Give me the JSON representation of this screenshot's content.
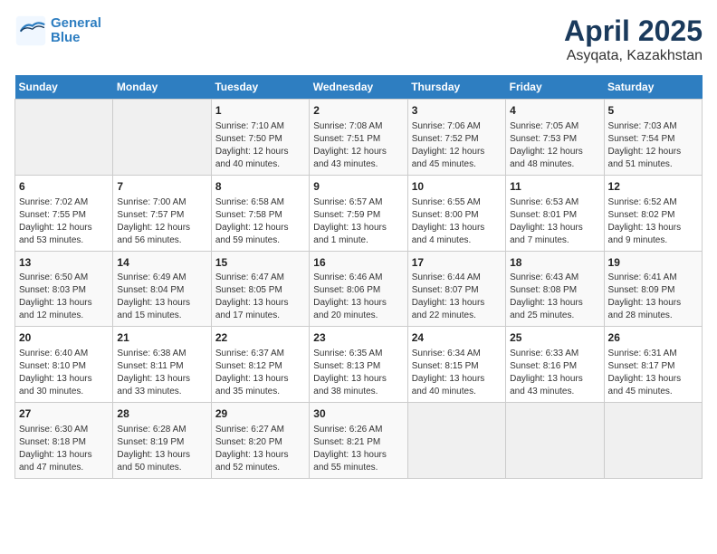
{
  "header": {
    "logo_line1": "General",
    "logo_line2": "Blue",
    "title": "April 2025",
    "subtitle": "Asyqata, Kazakhstan"
  },
  "days_of_week": [
    "Sunday",
    "Monday",
    "Tuesday",
    "Wednesday",
    "Thursday",
    "Friday",
    "Saturday"
  ],
  "weeks": [
    [
      {
        "day": "",
        "content": ""
      },
      {
        "day": "",
        "content": ""
      },
      {
        "day": "1",
        "content": "Sunrise: 7:10 AM\nSunset: 7:50 PM\nDaylight: 12 hours and 40 minutes."
      },
      {
        "day": "2",
        "content": "Sunrise: 7:08 AM\nSunset: 7:51 PM\nDaylight: 12 hours and 43 minutes."
      },
      {
        "day": "3",
        "content": "Sunrise: 7:06 AM\nSunset: 7:52 PM\nDaylight: 12 hours and 45 minutes."
      },
      {
        "day": "4",
        "content": "Sunrise: 7:05 AM\nSunset: 7:53 PM\nDaylight: 12 hours and 48 minutes."
      },
      {
        "day": "5",
        "content": "Sunrise: 7:03 AM\nSunset: 7:54 PM\nDaylight: 12 hours and 51 minutes."
      }
    ],
    [
      {
        "day": "6",
        "content": "Sunrise: 7:02 AM\nSunset: 7:55 PM\nDaylight: 12 hours and 53 minutes."
      },
      {
        "day": "7",
        "content": "Sunrise: 7:00 AM\nSunset: 7:57 PM\nDaylight: 12 hours and 56 minutes."
      },
      {
        "day": "8",
        "content": "Sunrise: 6:58 AM\nSunset: 7:58 PM\nDaylight: 12 hours and 59 minutes."
      },
      {
        "day": "9",
        "content": "Sunrise: 6:57 AM\nSunset: 7:59 PM\nDaylight: 13 hours and 1 minute."
      },
      {
        "day": "10",
        "content": "Sunrise: 6:55 AM\nSunset: 8:00 PM\nDaylight: 13 hours and 4 minutes."
      },
      {
        "day": "11",
        "content": "Sunrise: 6:53 AM\nSunset: 8:01 PM\nDaylight: 13 hours and 7 minutes."
      },
      {
        "day": "12",
        "content": "Sunrise: 6:52 AM\nSunset: 8:02 PM\nDaylight: 13 hours and 9 minutes."
      }
    ],
    [
      {
        "day": "13",
        "content": "Sunrise: 6:50 AM\nSunset: 8:03 PM\nDaylight: 13 hours and 12 minutes."
      },
      {
        "day": "14",
        "content": "Sunrise: 6:49 AM\nSunset: 8:04 PM\nDaylight: 13 hours and 15 minutes."
      },
      {
        "day": "15",
        "content": "Sunrise: 6:47 AM\nSunset: 8:05 PM\nDaylight: 13 hours and 17 minutes."
      },
      {
        "day": "16",
        "content": "Sunrise: 6:46 AM\nSunset: 8:06 PM\nDaylight: 13 hours and 20 minutes."
      },
      {
        "day": "17",
        "content": "Sunrise: 6:44 AM\nSunset: 8:07 PM\nDaylight: 13 hours and 22 minutes."
      },
      {
        "day": "18",
        "content": "Sunrise: 6:43 AM\nSunset: 8:08 PM\nDaylight: 13 hours and 25 minutes."
      },
      {
        "day": "19",
        "content": "Sunrise: 6:41 AM\nSunset: 8:09 PM\nDaylight: 13 hours and 28 minutes."
      }
    ],
    [
      {
        "day": "20",
        "content": "Sunrise: 6:40 AM\nSunset: 8:10 PM\nDaylight: 13 hours and 30 minutes."
      },
      {
        "day": "21",
        "content": "Sunrise: 6:38 AM\nSunset: 8:11 PM\nDaylight: 13 hours and 33 minutes."
      },
      {
        "day": "22",
        "content": "Sunrise: 6:37 AM\nSunset: 8:12 PM\nDaylight: 13 hours and 35 minutes."
      },
      {
        "day": "23",
        "content": "Sunrise: 6:35 AM\nSunset: 8:13 PM\nDaylight: 13 hours and 38 minutes."
      },
      {
        "day": "24",
        "content": "Sunrise: 6:34 AM\nSunset: 8:15 PM\nDaylight: 13 hours and 40 minutes."
      },
      {
        "day": "25",
        "content": "Sunrise: 6:33 AM\nSunset: 8:16 PM\nDaylight: 13 hours and 43 minutes."
      },
      {
        "day": "26",
        "content": "Sunrise: 6:31 AM\nSunset: 8:17 PM\nDaylight: 13 hours and 45 minutes."
      }
    ],
    [
      {
        "day": "27",
        "content": "Sunrise: 6:30 AM\nSunset: 8:18 PM\nDaylight: 13 hours and 47 minutes."
      },
      {
        "day": "28",
        "content": "Sunrise: 6:28 AM\nSunset: 8:19 PM\nDaylight: 13 hours and 50 minutes."
      },
      {
        "day": "29",
        "content": "Sunrise: 6:27 AM\nSunset: 8:20 PM\nDaylight: 13 hours and 52 minutes."
      },
      {
        "day": "30",
        "content": "Sunrise: 6:26 AM\nSunset: 8:21 PM\nDaylight: 13 hours and 55 minutes."
      },
      {
        "day": "",
        "content": ""
      },
      {
        "day": "",
        "content": ""
      },
      {
        "day": "",
        "content": ""
      }
    ]
  ]
}
